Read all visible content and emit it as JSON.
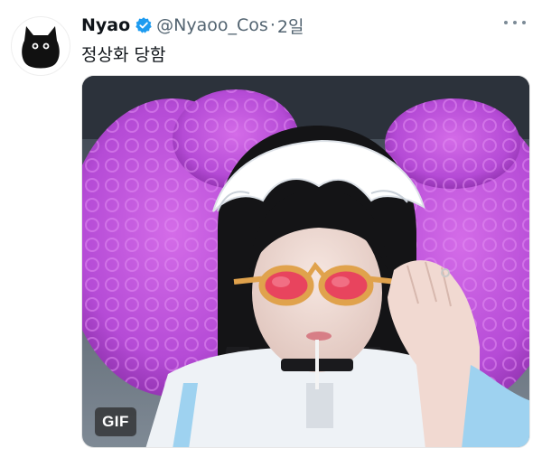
{
  "tweet": {
    "author_name": "Nyao",
    "handle": "@Nyaoo_Cos",
    "separator": "·",
    "timestamp": "2일",
    "text": "정상화 당함",
    "media": {
      "badge": "GIF"
    }
  },
  "colors": {
    "verified": "#1d9bf0",
    "wig": "#b54bd6",
    "lens": "#e8445e"
  },
  "icons": {
    "avatar": "black-cat-avatar",
    "verified": "verified-badge-icon",
    "more": "more-options-icon"
  }
}
